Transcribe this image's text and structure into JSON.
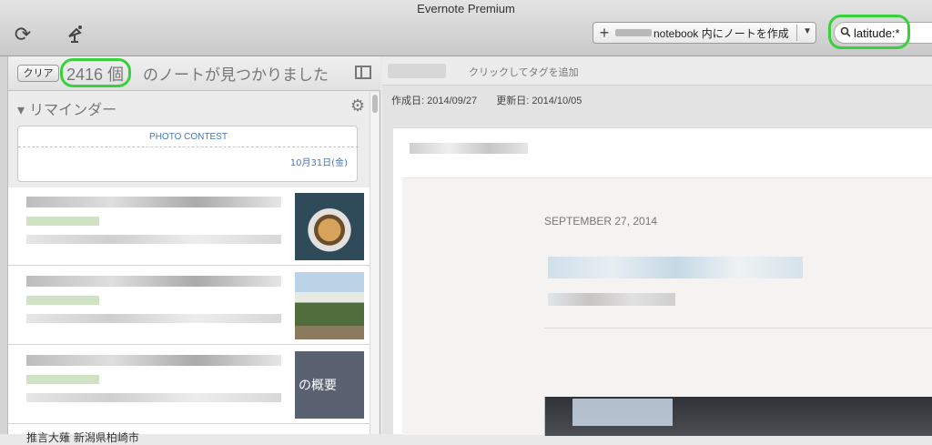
{
  "window": {
    "title": "Evernote Premium"
  },
  "toolbar": {
    "sync_icon": "sync-icon",
    "activity_icon": "satellite-dish-icon",
    "new_note_label": "notebook 内にノートを作成",
    "new_note_prefix": "",
    "search_value": "latitude:*"
  },
  "list": {
    "clear_label": "クリア",
    "count": "2416 個",
    "count_suffix": "のノートが見つかりました",
    "reminder_title": "リマインダー",
    "reminder_card_label": "PHOTO CONTEST",
    "reminder_card_date": "10月31日(金)",
    "note3_image_text": "の概要",
    "bottom_cut_text": "推言大薙 新潟県柏崎市"
  },
  "note": {
    "tag_add": "クリックしてタグを追加",
    "created": "作成日: 2014/09/27",
    "updated": "更新日: 2014/10/05",
    "date_heading": "SEPTEMBER 27, 2014"
  },
  "colors": {
    "highlight": "#38d13c",
    "accent": "#4a76b4"
  }
}
